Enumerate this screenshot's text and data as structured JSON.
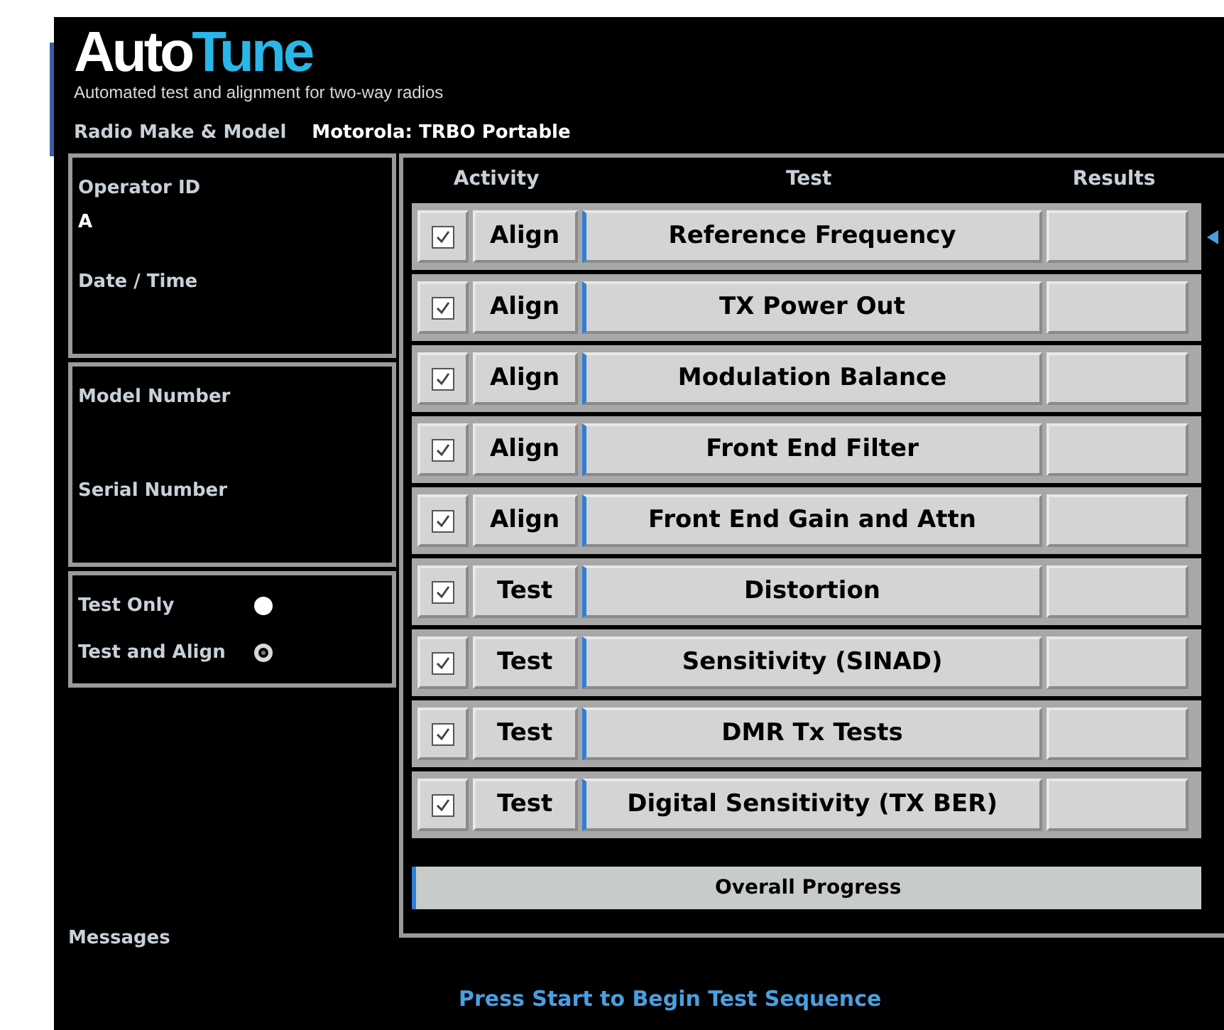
{
  "logo": {
    "part_1": "Auto",
    "part_2": "Tune"
  },
  "tagline": "Automated test and alignment for two-way radios",
  "radio": {
    "label": "Radio Make & Model",
    "value": "Motorola: TRBO Portable"
  },
  "info_panels": [
    {
      "fields": [
        {
          "label": "Operator ID",
          "value": "A"
        },
        {
          "label": "Date / Time"
        }
      ]
    },
    {
      "fields": [
        {
          "label": "Model Number"
        },
        {
          "label": "Serial Number"
        }
      ]
    }
  ],
  "mode_options": [
    {
      "label": "Test Only",
      "selected": false
    },
    {
      "label": "Test and Align",
      "selected": true
    }
  ],
  "messages_label": "Messages",
  "columns": [
    "Activity",
    "Test",
    "Results"
  ],
  "tests": [
    {
      "checked": true,
      "activity": "Align",
      "test": "Reference Frequency",
      "current": true
    },
    {
      "checked": true,
      "activity": "Align",
      "test": "TX Power Out",
      "current": false
    },
    {
      "checked": true,
      "activity": "Align",
      "test": "Modulation Balance",
      "current": false
    },
    {
      "checked": true,
      "activity": "Align",
      "test": "Front End Filter",
      "current": false
    },
    {
      "checked": true,
      "activity": "Align",
      "test": "Front End Gain and Attn",
      "current": false
    },
    {
      "checked": true,
      "activity": "Test",
      "test": "Distortion",
      "current": false
    },
    {
      "checked": true,
      "activity": "Test",
      "test": "Sensitivity (SINAD)",
      "current": false
    },
    {
      "checked": true,
      "activity": "Test",
      "test": "DMR Tx Tests",
      "current": false
    },
    {
      "checked": true,
      "activity": "Test",
      "test": "Digital Sensitivity (TX BER)",
      "current": false
    }
  ],
  "overall_progress": {
    "label": "Overall Progress"
  },
  "status_message": "Press Start to Begin Test Sequence"
}
